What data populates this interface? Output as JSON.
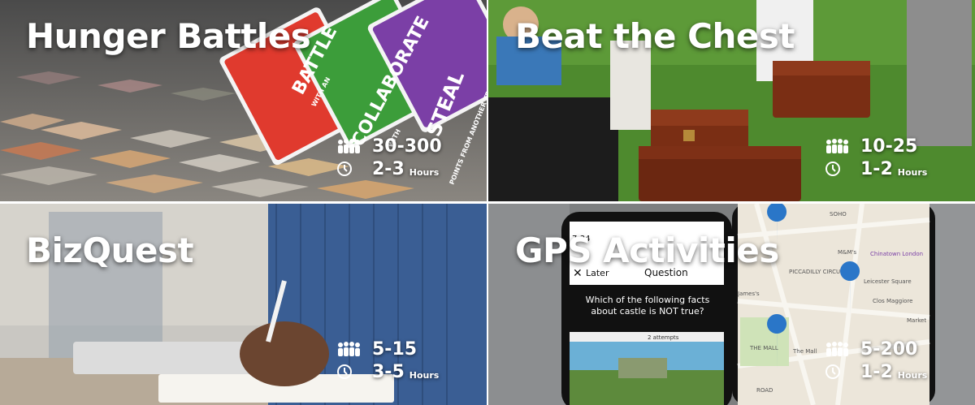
{
  "tiles": [
    {
      "title": "Hunger Battles",
      "people": "30-300",
      "duration": "2-3",
      "unit": "Hours",
      "photo_text": {
        "card1": "BATTLE",
        "card1_sub": "WITH AN",
        "card2": "COLLABORATE",
        "card2_sub": "WITH",
        "card3": "STEAL",
        "card3_sub": "POINTS FROM ANOTHER TEAM"
      }
    },
    {
      "title": "Beat the Chest",
      "people": "10-25",
      "duration": "1-2",
      "unit": "Hours"
    },
    {
      "title": "BizQuest",
      "people": "5-15",
      "duration": "3-5",
      "unit": "Hours"
    },
    {
      "title": "GPS Activities",
      "people": "5-200",
      "duration": "1-2",
      "unit": "Hours",
      "phone": {
        "time": "7:34",
        "later": "Later",
        "header": "Question",
        "question": "Which of the following facts about castle is NOT true?",
        "attempts": "2 attempts"
      },
      "map_labels": [
        "SOHO",
        "Chinatown London",
        "M&M's",
        "PICCADILLY CIRCUS",
        "Leicester Square",
        "Clos Maggiore",
        "James's",
        "Market",
        "THE MALL",
        "The Mall",
        "ROAD"
      ]
    }
  ],
  "icons": {
    "people": "group-icon",
    "clock": "clock-icon"
  },
  "colors": {
    "text": "#ffffff",
    "battle_card": "#e03a2e",
    "collaborate_card": "#3c9d3a",
    "steal_card": "#7b3fa6",
    "grass": "#4e8a2e",
    "chest": "#7a2e14"
  }
}
